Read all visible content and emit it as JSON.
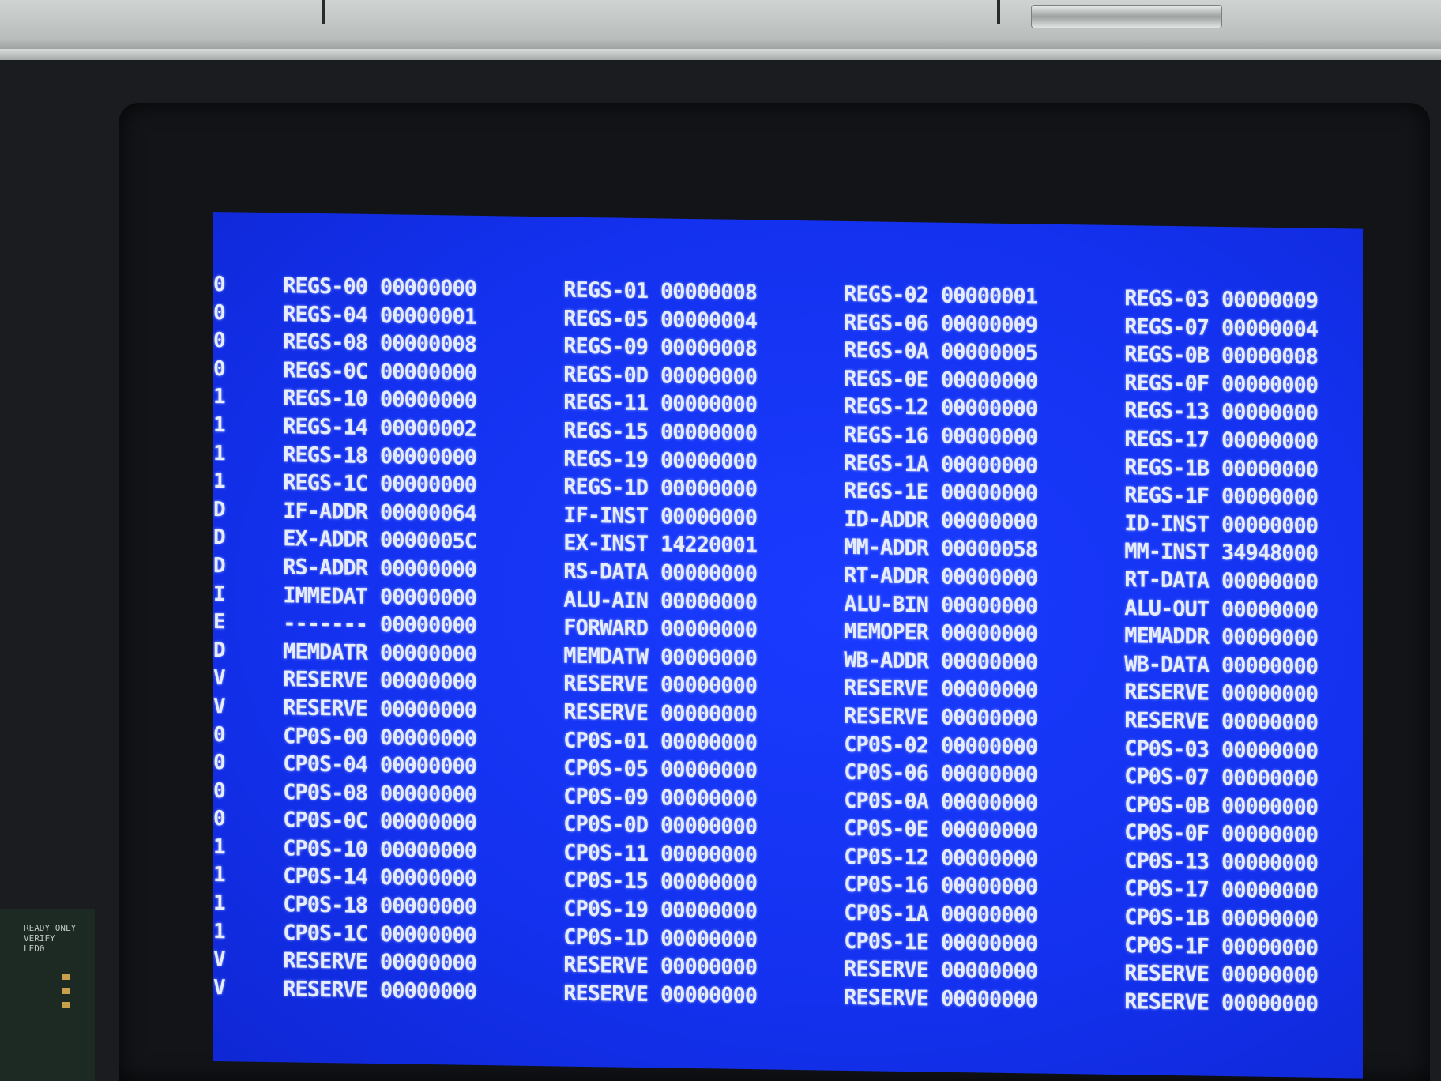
{
  "markers": [
    "0",
    "0",
    "0",
    "0",
    "1",
    "1",
    "1",
    "1",
    "D",
    "D",
    "D",
    "I",
    "E",
    "D",
    "V",
    "V",
    "0",
    "0",
    "0",
    "0",
    "1",
    "1",
    "1",
    "1",
    "V",
    "V"
  ],
  "board_label": "READY ONLY\nVERIFY\nLED0",
  "columns": [
    {
      "rows": [
        {
          "label": "REGS-00",
          "value": "00000000"
        },
        {
          "label": "REGS-04",
          "value": "00000001"
        },
        {
          "label": "REGS-08",
          "value": "00000008"
        },
        {
          "label": "REGS-0C",
          "value": "00000000"
        },
        {
          "label": "REGS-10",
          "value": "00000000"
        },
        {
          "label": "REGS-14",
          "value": "00000002"
        },
        {
          "label": "REGS-18",
          "value": "00000000"
        },
        {
          "label": "REGS-1C",
          "value": "00000000"
        },
        {
          "label": "IF-ADDR",
          "value": "00000064"
        },
        {
          "label": "EX-ADDR",
          "value": "0000005C"
        },
        {
          "label": "RS-ADDR",
          "value": "00000000"
        },
        {
          "label": "IMMEDAT",
          "value": "00000000"
        },
        {
          "label": "-------",
          "value": "00000000"
        },
        {
          "label": "MEMDATR",
          "value": "00000000"
        },
        {
          "label": "RESERVE",
          "value": "00000000"
        },
        {
          "label": "RESERVE",
          "value": "00000000"
        },
        {
          "label": "CP0S-00",
          "value": "00000000"
        },
        {
          "label": "CP0S-04",
          "value": "00000000"
        },
        {
          "label": "CP0S-08",
          "value": "00000000"
        },
        {
          "label": "CP0S-0C",
          "value": "00000000"
        },
        {
          "label": "CP0S-10",
          "value": "00000000"
        },
        {
          "label": "CP0S-14",
          "value": "00000000"
        },
        {
          "label": "CP0S-18",
          "value": "00000000"
        },
        {
          "label": "CP0S-1C",
          "value": "00000000"
        },
        {
          "label": "RESERVE",
          "value": "00000000"
        },
        {
          "label": "RESERVE",
          "value": "00000000"
        }
      ]
    },
    {
      "rows": [
        {
          "label": "REGS-01",
          "value": "00000008"
        },
        {
          "label": "REGS-05",
          "value": "00000004"
        },
        {
          "label": "REGS-09",
          "value": "00000008"
        },
        {
          "label": "REGS-0D",
          "value": "00000000"
        },
        {
          "label": "REGS-11",
          "value": "00000000"
        },
        {
          "label": "REGS-15",
          "value": "00000000"
        },
        {
          "label": "REGS-19",
          "value": "00000000"
        },
        {
          "label": "REGS-1D",
          "value": "00000000"
        },
        {
          "label": "IF-INST",
          "value": "00000000"
        },
        {
          "label": "EX-INST",
          "value": "14220001"
        },
        {
          "label": "RS-DATA",
          "value": "00000000"
        },
        {
          "label": "ALU-AIN",
          "value": "00000000"
        },
        {
          "label": "FORWARD",
          "value": "00000000"
        },
        {
          "label": "MEMDATW",
          "value": "00000000"
        },
        {
          "label": "RESERVE",
          "value": "00000000"
        },
        {
          "label": "RESERVE",
          "value": "00000000"
        },
        {
          "label": "CP0S-01",
          "value": "00000000"
        },
        {
          "label": "CP0S-05",
          "value": "00000000"
        },
        {
          "label": "CP0S-09",
          "value": "00000000"
        },
        {
          "label": "CP0S-0D",
          "value": "00000000"
        },
        {
          "label": "CP0S-11",
          "value": "00000000"
        },
        {
          "label": "CP0S-15",
          "value": "00000000"
        },
        {
          "label": "CP0S-19",
          "value": "00000000"
        },
        {
          "label": "CP0S-1D",
          "value": "00000000"
        },
        {
          "label": "RESERVE",
          "value": "00000000"
        },
        {
          "label": "RESERVE",
          "value": "00000000"
        }
      ]
    },
    {
      "rows": [
        {
          "label": "REGS-02",
          "value": "00000001"
        },
        {
          "label": "REGS-06",
          "value": "00000009"
        },
        {
          "label": "REGS-0A",
          "value": "00000005"
        },
        {
          "label": "REGS-0E",
          "value": "00000000"
        },
        {
          "label": "REGS-12",
          "value": "00000000"
        },
        {
          "label": "REGS-16",
          "value": "00000000"
        },
        {
          "label": "REGS-1A",
          "value": "00000000"
        },
        {
          "label": "REGS-1E",
          "value": "00000000"
        },
        {
          "label": "ID-ADDR",
          "value": "00000000"
        },
        {
          "label": "MM-ADDR",
          "value": "00000058"
        },
        {
          "label": "RT-ADDR",
          "value": "00000000"
        },
        {
          "label": "ALU-BIN",
          "value": "00000000"
        },
        {
          "label": "MEMOPER",
          "value": "00000000"
        },
        {
          "label": "WB-ADDR",
          "value": "00000000"
        },
        {
          "label": "RESERVE",
          "value": "00000000"
        },
        {
          "label": "RESERVE",
          "value": "00000000"
        },
        {
          "label": "CP0S-02",
          "value": "00000000"
        },
        {
          "label": "CP0S-06",
          "value": "00000000"
        },
        {
          "label": "CP0S-0A",
          "value": "00000000"
        },
        {
          "label": "CP0S-0E",
          "value": "00000000"
        },
        {
          "label": "CP0S-12",
          "value": "00000000"
        },
        {
          "label": "CP0S-16",
          "value": "00000000"
        },
        {
          "label": "CP0S-1A",
          "value": "00000000"
        },
        {
          "label": "CP0S-1E",
          "value": "00000000"
        },
        {
          "label": "RESERVE",
          "value": "00000000"
        },
        {
          "label": "RESERVE",
          "value": "00000000"
        }
      ]
    },
    {
      "rows": [
        {
          "label": "REGS-03",
          "value": "00000009"
        },
        {
          "label": "REGS-07",
          "value": "00000004"
        },
        {
          "label": "REGS-0B",
          "value": "00000008"
        },
        {
          "label": "REGS-0F",
          "value": "00000000"
        },
        {
          "label": "REGS-13",
          "value": "00000000"
        },
        {
          "label": "REGS-17",
          "value": "00000000"
        },
        {
          "label": "REGS-1B",
          "value": "00000000"
        },
        {
          "label": "REGS-1F",
          "value": "00000000"
        },
        {
          "label": "ID-INST",
          "value": "00000000"
        },
        {
          "label": "MM-INST",
          "value": "34948000"
        },
        {
          "label": "RT-DATA",
          "value": "00000000"
        },
        {
          "label": "ALU-OUT",
          "value": "00000000"
        },
        {
          "label": "MEMADDR",
          "value": "00000000"
        },
        {
          "label": "WB-DATA",
          "value": "00000000"
        },
        {
          "label": "RESERVE",
          "value": "00000000"
        },
        {
          "label": "RESERVE",
          "value": "00000000"
        },
        {
          "label": "CP0S-03",
          "value": "00000000"
        },
        {
          "label": "CP0S-07",
          "value": "00000000"
        },
        {
          "label": "CP0S-0B",
          "value": "00000000"
        },
        {
          "label": "CP0S-0F",
          "value": "00000000"
        },
        {
          "label": "CP0S-13",
          "value": "00000000"
        },
        {
          "label": "CP0S-17",
          "value": "00000000"
        },
        {
          "label": "CP0S-1B",
          "value": "00000000"
        },
        {
          "label": "CP0S-1F",
          "value": "00000000"
        },
        {
          "label": "RESERVE",
          "value": "00000000"
        },
        {
          "label": "RESERVE",
          "value": "00000000"
        }
      ]
    }
  ]
}
